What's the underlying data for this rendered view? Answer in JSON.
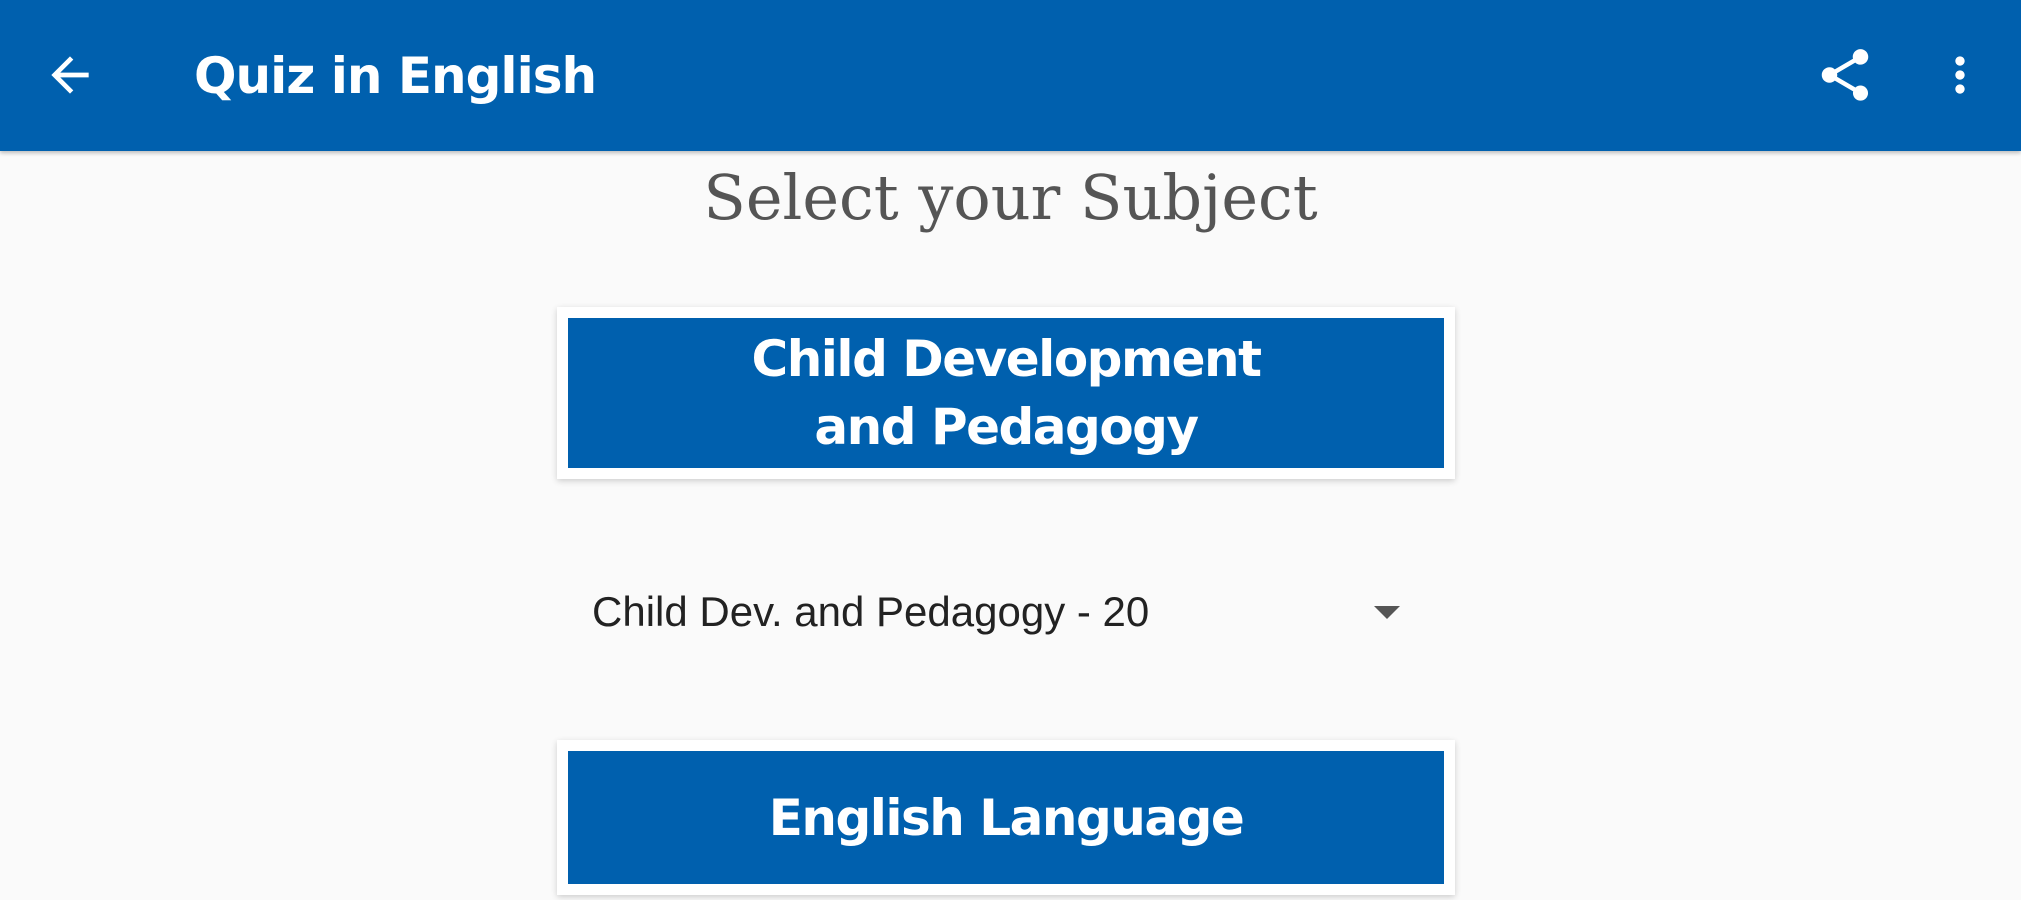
{
  "appbar": {
    "title": "Quiz in English",
    "back_icon": "arrow-back-icon",
    "share_icon": "share-icon",
    "more_icon": "more-vert-icon",
    "color": "#0060ae"
  },
  "main": {
    "heading": "Select your Subject",
    "subjects": [
      {
        "label_line1": "Child Development",
        "label_line2": "and Pedagogy"
      },
      {
        "label_line1": "English Language"
      }
    ],
    "quiz_select": {
      "selected": "Child Dev. and Pedagogy - 20",
      "icon": "dropdown-arrow-icon"
    }
  }
}
